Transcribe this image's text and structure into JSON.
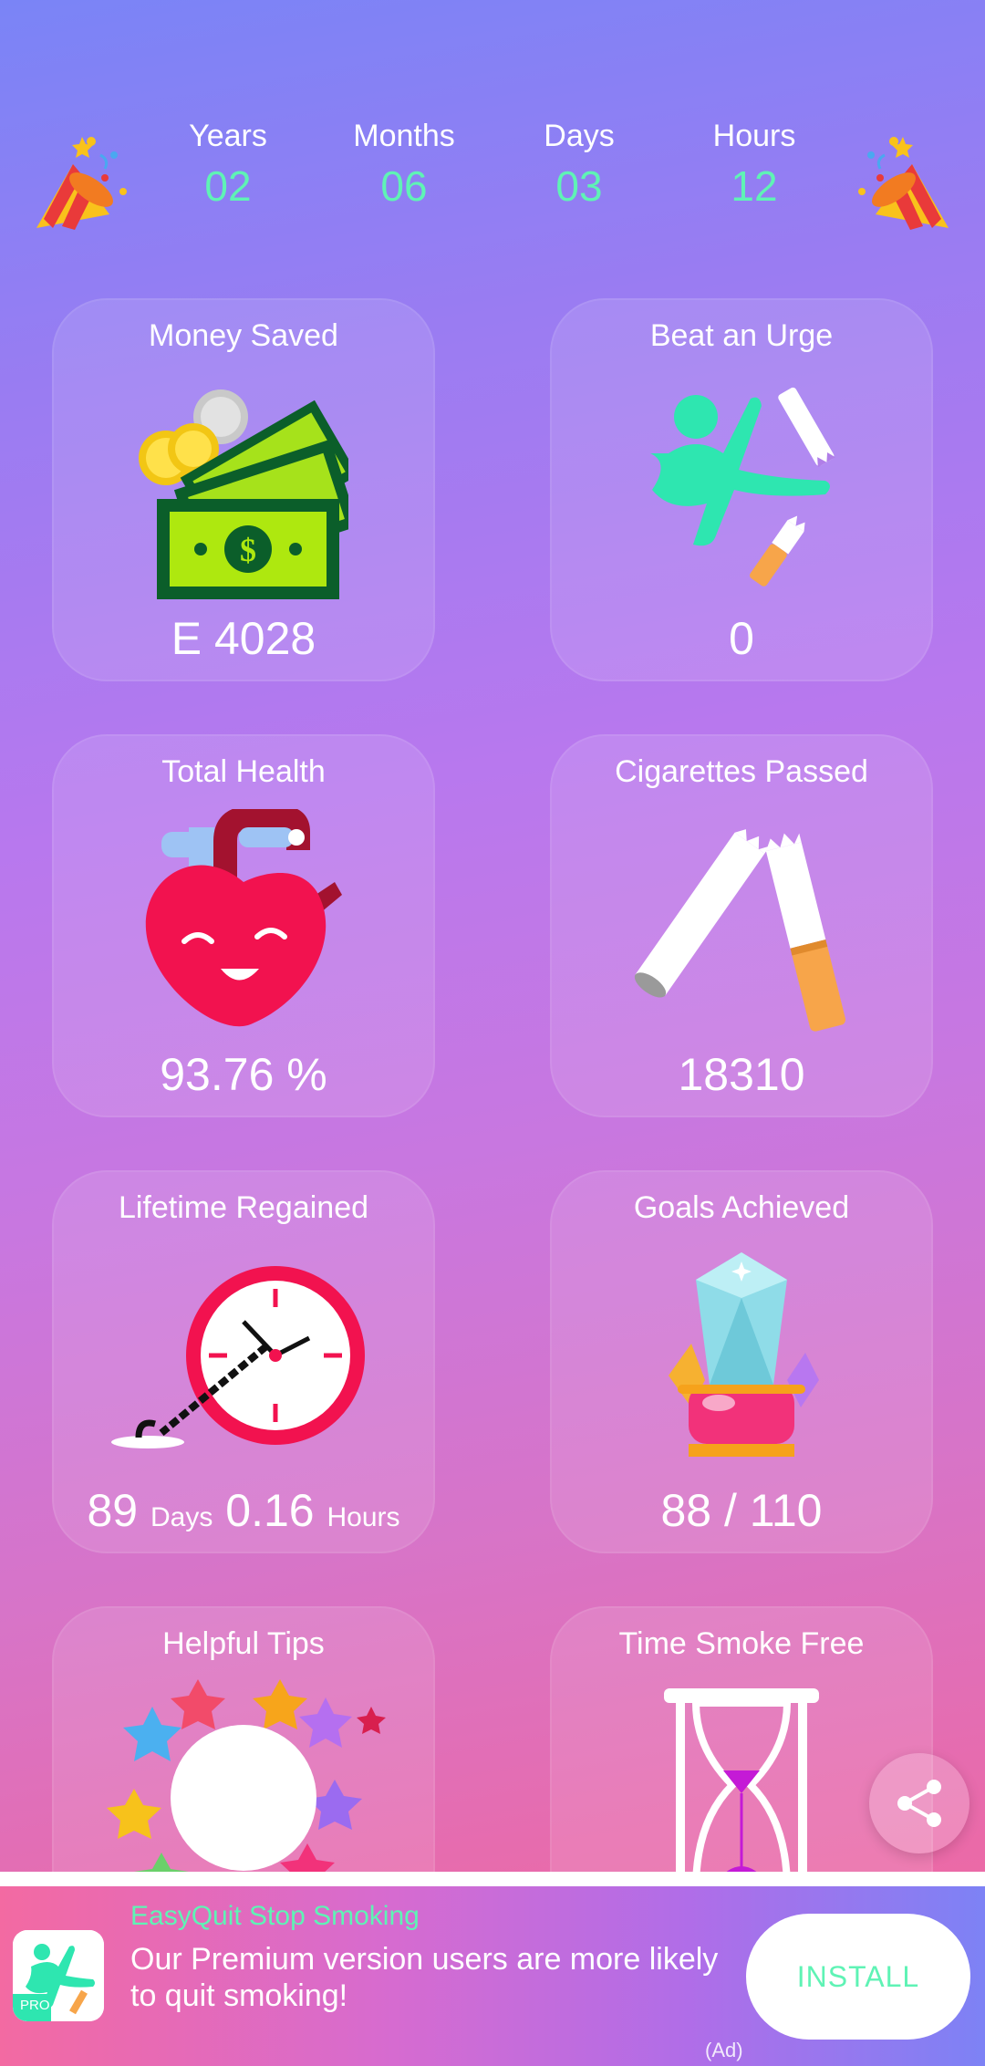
{
  "counter": {
    "years": {
      "label": "Years",
      "value": "02"
    },
    "months": {
      "label": "Months",
      "value": "06"
    },
    "days": {
      "label": "Days",
      "value": "03"
    },
    "hours": {
      "label": "Hours",
      "value": "12"
    }
  },
  "cards": {
    "money": {
      "title": "Money Saved",
      "value": "E 4028"
    },
    "urge": {
      "title": "Beat an Urge",
      "value": "0"
    },
    "health": {
      "title": "Total Health",
      "value": "93.76 %"
    },
    "cigs": {
      "title": "Cigarettes Passed",
      "value": "18310"
    },
    "lifetime": {
      "title": "Lifetime Regained",
      "days_value": "89",
      "days_unit": "Days",
      "hours_value": "0.16",
      "hours_unit": "Hours"
    },
    "goals": {
      "title": "Goals Achieved",
      "value": "88 / 110"
    },
    "tips": {
      "title": "Helpful Tips"
    },
    "time": {
      "title": "Time Smoke Free"
    }
  },
  "ad": {
    "app_name": "EasyQuit Stop Smoking",
    "description": "Our Premium version users are more likely to quit smoking!",
    "install_label": "INSTALL",
    "ad_tag": "(Ad)",
    "icon_badge": "PRO"
  },
  "colors": {
    "accent_green": "#5ff3b5",
    "heart": "#f2124f",
    "bill": "#aee80f"
  },
  "icons": [
    "party-popper-icon",
    "money-icon",
    "karate-kick-icon",
    "heart-icon",
    "broken-cigarette-icon",
    "clock-icon",
    "crystal-trophy-icon",
    "lightbulb-stars-icon",
    "hourglass-icon",
    "share-icon"
  ]
}
